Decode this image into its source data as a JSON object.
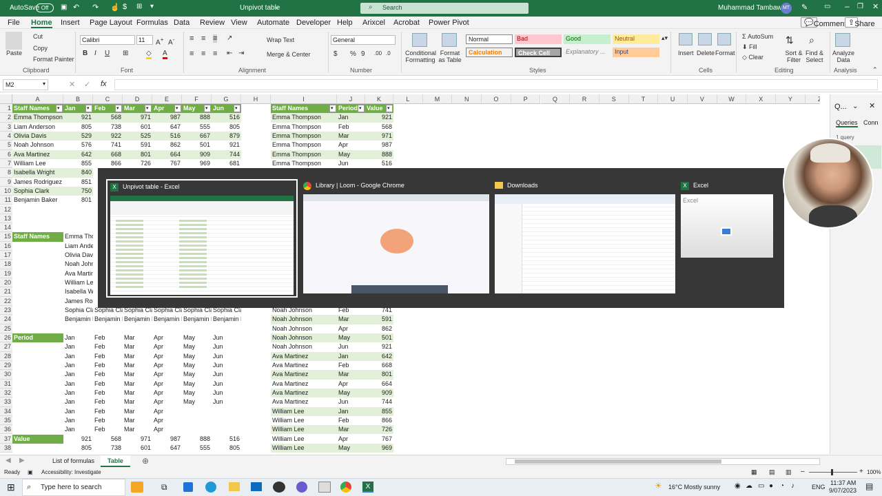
{
  "titlebar": {
    "autosave": "AutoSave",
    "autosave_state": "Off",
    "doc_title": "Unpivot table",
    "search": "Search",
    "user": "Muhammad Tambawala",
    "initials": "MT"
  },
  "menu": [
    "File",
    "Home",
    "Insert",
    "Page Layout",
    "Formulas",
    "Data",
    "Review",
    "View",
    "Automate",
    "Developer",
    "Help",
    "Arixcel",
    "Acrobat",
    "Power Pivot"
  ],
  "menu_right": {
    "comments": "Comments",
    "share": "Share"
  },
  "ribbon": {
    "paste": "Paste",
    "cut": "Cut",
    "copy": "Copy",
    "format_painter": "Format Painter",
    "clipboard": "Clipboard",
    "font_name": "Calibri",
    "font_size": "11",
    "font": "Font",
    "wrap": "Wrap Text",
    "merge": "Merge & Center",
    "alignment": "Alignment",
    "numfmt": "General",
    "number": "Number",
    "cond": "Conditional Formatting",
    "fmt_table": "Format as Table",
    "styles": [
      "Normal",
      "Bad",
      "Good",
      "Neutral",
      "Calculation",
      "Check Cell",
      "Explanatory ...",
      "Input"
    ],
    "styles_label": "Styles",
    "insert": "Insert",
    "delete": "Delete",
    "format": "Format",
    "cells": "Cells",
    "autosum": "AutoSum",
    "fill": "Fill",
    "clear": "Clear",
    "sort": "Sort & Filter",
    "find": "Find & Select",
    "editing": "Editing",
    "analyze": "Analyze Data",
    "analysis": "Analysis"
  },
  "namebox": "M2",
  "fx": "fx",
  "columns": [
    "A",
    "B",
    "C",
    "D",
    "E",
    "F",
    "G",
    "H",
    "I",
    "J",
    "K",
    "L",
    "M",
    "N",
    "O",
    "P",
    "Q",
    "R",
    "S",
    "T",
    "U",
    "V",
    "W",
    "X",
    "Y",
    "Z"
  ],
  "table1": {
    "headers": [
      "Staff Names",
      "Jan",
      "Feb",
      "Mar",
      "Apr",
      "May",
      "Jun"
    ],
    "rows": [
      [
        "Emma Thompson",
        "921",
        "568",
        "971",
        "987",
        "888",
        "516"
      ],
      [
        "Liam Anderson",
        "805",
        "738",
        "601",
        "647",
        "555",
        "805"
      ],
      [
        "Olivia Davis",
        "529",
        "922",
        "525",
        "516",
        "667",
        "879"
      ],
      [
        "Noah Johnson",
        "576",
        "741",
        "591",
        "862",
        "501",
        "921"
      ],
      [
        "Ava Martinez",
        "642",
        "668",
        "801",
        "664",
        "909",
        "744"
      ],
      [
        "William Lee",
        "855",
        "866",
        "726",
        "767",
        "969",
        "681"
      ],
      [
        "Isabella Wright",
        "840",
        "",
        "",
        "",
        "",
        ""
      ],
      [
        "James Rodriguez",
        "851",
        "",
        "",
        "",
        "",
        ""
      ],
      [
        "Sophia Clark",
        "750",
        "",
        "",
        "",
        "",
        ""
      ],
      [
        "Benjamin Baker",
        "801",
        "",
        "",
        "",
        "",
        ""
      ]
    ]
  },
  "table2": {
    "headers": [
      "Staff Names",
      "Period",
      "Value"
    ],
    "rows": [
      [
        "Emma Thompson",
        "Jan",
        "921"
      ],
      [
        "Emma Thompson",
        "Feb",
        "568"
      ],
      [
        "Emma Thompson",
        "Mar",
        "971"
      ],
      [
        "Emma Thompson",
        "Apr",
        "987"
      ],
      [
        "Emma Thompson",
        "May",
        "888"
      ],
      [
        "Emma Thompson",
        "Jun",
        "516"
      ],
      [
        "Noah Johnson",
        "Feb",
        "741"
      ],
      [
        "Noah Johnson",
        "Mar",
        "591"
      ],
      [
        "Noah Johnson",
        "Apr",
        "862"
      ],
      [
        "Noah Johnson",
        "May",
        "501"
      ],
      [
        "Noah Johnson",
        "Jun",
        "921"
      ],
      [
        "Ava Martinez",
        "Jan",
        "642"
      ],
      [
        "Ava Martinez",
        "Feb",
        "668"
      ],
      [
        "Ava Martinez",
        "Mar",
        "801"
      ],
      [
        "Ava Martinez",
        "Apr",
        "664"
      ],
      [
        "Ava Martinez",
        "May",
        "909"
      ],
      [
        "Ava Martinez",
        "Jun",
        "744"
      ],
      [
        "William Lee",
        "Jan",
        "855"
      ],
      [
        "William Lee",
        "Feb",
        "866"
      ],
      [
        "William Lee",
        "Mar",
        "726"
      ],
      [
        "William Lee",
        "Apr",
        "767"
      ],
      [
        "William Lee",
        "May",
        "969"
      ]
    ]
  },
  "lower": {
    "staff_label": "Staff Names",
    "period_label": "Period",
    "value_label": "Value",
    "staff_col": [
      "Emma Thompson",
      "Liam Anderson",
      "Olivia Davis",
      "Noah Johnson",
      "Ava Martinez",
      "William Lee",
      "Isabella Wright",
      "James Rodriguez"
    ],
    "row23": [
      "Sophia Clark",
      "Sophia Clark",
      "Sophia Clark",
      "Sophia Clark",
      "Sophia Clark",
      "Sophia Clark"
    ],
    "row24": [
      "Benjamin Baker",
      "Benjamin Baker",
      "Benjamin Baker",
      "Benjamin Baker",
      "Benjamin Baker",
      "Benjamin Baker"
    ],
    "months": [
      "Jan",
      "Feb",
      "Mar",
      "Apr",
      "May",
      "Jun"
    ],
    "val37": [
      "921",
      "568",
      "971",
      "987",
      "888",
      "516"
    ],
    "val38": [
      "805",
      "738",
      "601",
      "647",
      "555",
      "805"
    ]
  },
  "switcher": [
    {
      "title": "Unpivot table - Excel"
    },
    {
      "title": "Library | Loom - Google Chrome"
    },
    {
      "title": "Downloads"
    },
    {
      "title": "Excel",
      "thumb_text": "Excel"
    }
  ],
  "rightpane": {
    "search": "Q...",
    "queries": "Queries",
    "conn": "Conn",
    "count": "1 query"
  },
  "tabs": {
    "sheet1": "List of formulas",
    "sheet2": "Table"
  },
  "status": {
    "ready": "Ready",
    "access": "Accessibility: Investigate",
    "zoom": "100%"
  },
  "taskbar": {
    "search": "Type here to search",
    "weather": "16°C  Mostly sunny",
    "lang": "ENG",
    "time": "11:37 AM",
    "date": "9/07/2023"
  }
}
